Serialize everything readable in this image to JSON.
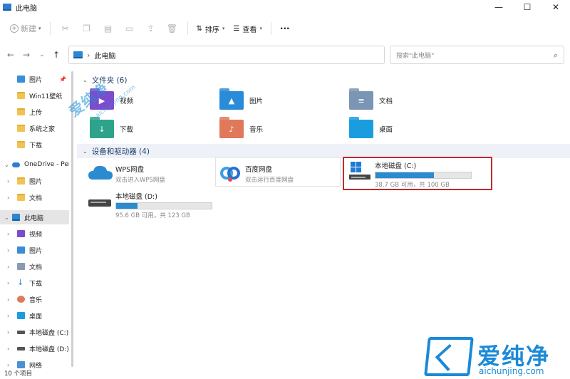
{
  "window": {
    "title": "此电脑",
    "minimize": "—",
    "maximize": "☐",
    "close": "✕"
  },
  "toolbar": {
    "new_label": "新建",
    "sort_label": "排序",
    "view_label": "查看",
    "more_label": "···"
  },
  "nav": {
    "back": "←",
    "forward": "→",
    "recent": "⌄",
    "up": "↑",
    "breadcrumb_sep": "›",
    "path": "此电脑"
  },
  "search": {
    "placeholder": "搜索\"此电脑\""
  },
  "sidebar": {
    "items": [
      {
        "label": "图片",
        "icon": "pictures-icon"
      },
      {
        "label": "Win11壁纸",
        "icon": "folder-icon"
      },
      {
        "label": "上传",
        "icon": "folder-icon"
      },
      {
        "label": "系统之家",
        "icon": "folder-icon"
      },
      {
        "label": "下载",
        "icon": "folder-icon"
      },
      {
        "label": "OneDrive - Pers",
        "icon": "cloud-icon"
      },
      {
        "label": "图片",
        "icon": "folder-icon"
      },
      {
        "label": "文档",
        "icon": "folder-icon"
      },
      {
        "label": "此电脑",
        "icon": "computer-icon"
      },
      {
        "label": "视频",
        "icon": "video-icon"
      },
      {
        "label": "图片",
        "icon": "pictures-icon"
      },
      {
        "label": "文档",
        "icon": "documents-icon"
      },
      {
        "label": "下载",
        "icon": "download-icon"
      },
      {
        "label": "音乐",
        "icon": "music-icon"
      },
      {
        "label": "桌面",
        "icon": "desktop-icon"
      },
      {
        "label": "本地磁盘 (C:)",
        "icon": "drive-icon"
      },
      {
        "label": "本地磁盘 (D:)",
        "icon": "drive-icon"
      },
      {
        "label": "网络",
        "icon": "network-icon"
      }
    ]
  },
  "folders_group": {
    "header": "文件夹 (6)",
    "items": [
      {
        "label": "视频",
        "icon": "video-folder-icon"
      },
      {
        "label": "图片",
        "icon": "pictures-folder-icon"
      },
      {
        "label": "文档",
        "icon": "documents-folder-icon"
      },
      {
        "label": "下载",
        "icon": "download-folder-icon"
      },
      {
        "label": "音乐",
        "icon": "music-folder-icon"
      },
      {
        "label": "桌面",
        "icon": "desktop-folder-icon"
      }
    ]
  },
  "devices_group": {
    "header": "设备和驱动器 (4)",
    "items": [
      {
        "name": "WPS网盘",
        "sub": "双击进入WPS网盘"
      },
      {
        "name": "百度网盘",
        "sub": "双击运行百度网盘"
      },
      {
        "name": "本地磁盘 (C:)",
        "sub": "38.7 GB 可用，共 100 GB",
        "used_fraction": 0.613
      },
      {
        "name": "本地磁盘 (D:)",
        "sub": "95.6 GB 可用，共 123 GB",
        "used_fraction": 0.223
      }
    ]
  },
  "status": {
    "count": "10 个项目"
  },
  "watermark": {
    "brand": "爱纯净",
    "url": "aichunjing.com"
  },
  "colors": {
    "accent": "#2a8bd0",
    "highlight_box": "#c12a2a",
    "watermark": "#1a8ad8"
  }
}
